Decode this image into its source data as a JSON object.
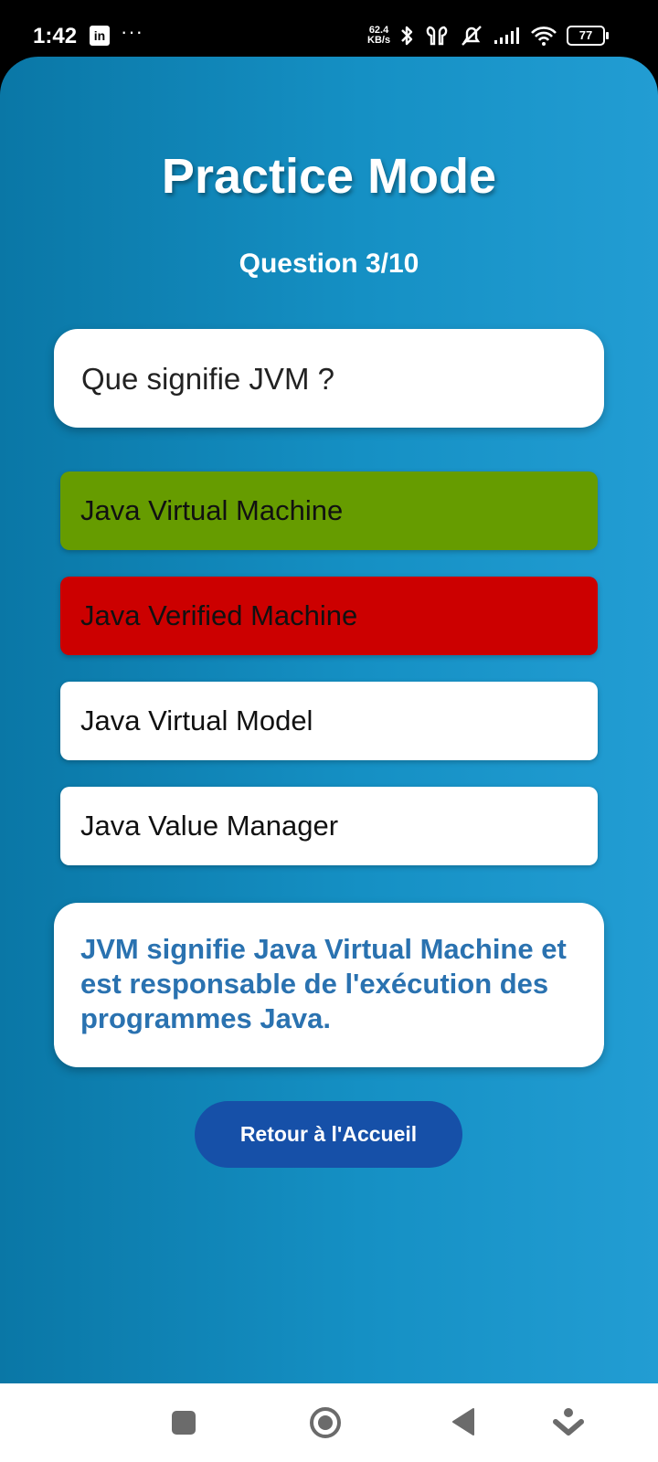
{
  "status_bar": {
    "time": "1:42",
    "app_icon_letters": "in",
    "more_dots": "···",
    "net_speed_value": "62.4",
    "net_speed_unit": "KB/s",
    "battery": "77"
  },
  "screen": {
    "title": "Practice Mode",
    "question_counter": "Question 3/10",
    "question": "Que signifie JVM ?",
    "options": [
      {
        "label": "Java Virtual Machine",
        "state": "correct",
        "color": "#669c00"
      },
      {
        "label": "Java Verified Machine",
        "state": "wrong",
        "color": "#cc0000"
      },
      {
        "label": "Java Virtual Model",
        "state": "neutral",
        "color": "#ffffff"
      },
      {
        "label": "Java Value Manager",
        "state": "neutral",
        "color": "#ffffff"
      }
    ],
    "explanation": "JVM signifie Java Virtual Machine et est responsable de l'exécution des programmes Java.",
    "home_button": "Retour à l'Accueil"
  },
  "nav_bar": {
    "icons": [
      "recents-square-icon",
      "home-circle-icon",
      "back-triangle-icon",
      "assistant-icon"
    ]
  },
  "colors": {
    "gradient_start": "#0a77a6",
    "gradient_end": "#229dd3",
    "button": "#1650a8",
    "explanation_text": "#2a72b0"
  }
}
